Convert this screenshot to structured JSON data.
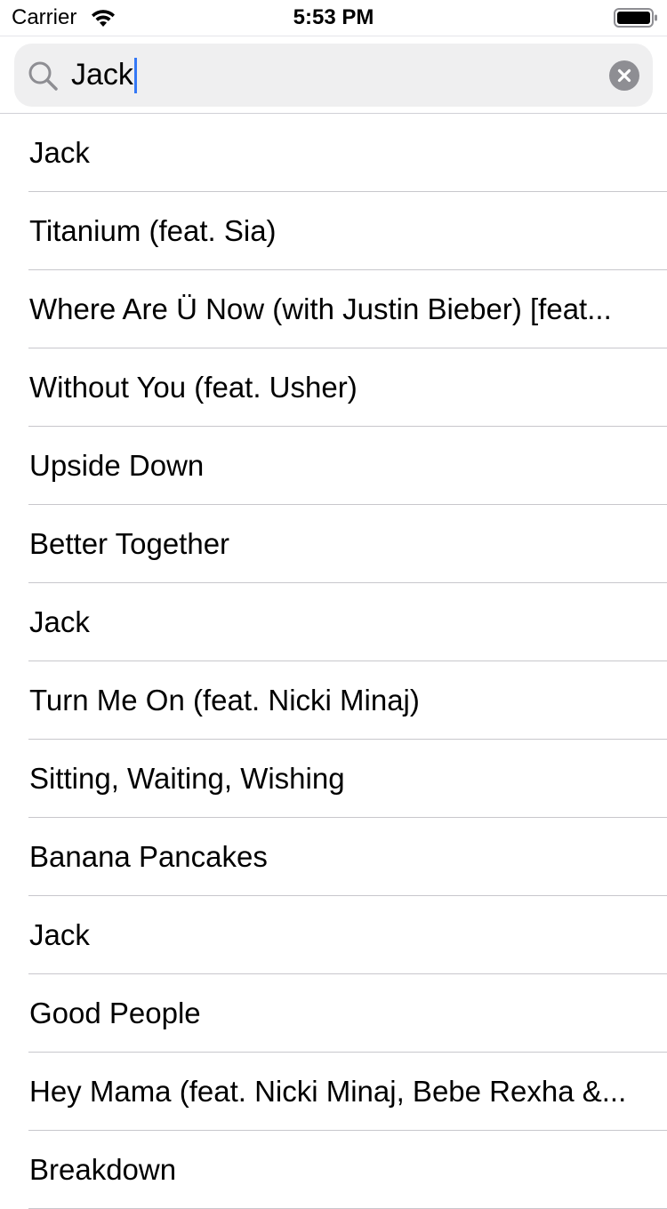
{
  "status_bar": {
    "carrier": "Carrier",
    "time": "5:53 PM"
  },
  "search": {
    "value": "Jack",
    "icon": "search-icon",
    "clear_icon": "clear-icon"
  },
  "results": [
    {
      "label": "Jack"
    },
    {
      "label": "Titanium (feat. Sia)"
    },
    {
      "label": "Where Are Ü Now (with Justin Bieber) [feat..."
    },
    {
      "label": "Without You (feat. Usher)"
    },
    {
      "label": "Upside Down"
    },
    {
      "label": "Better Together"
    },
    {
      "label": "Jack"
    },
    {
      "label": "Turn Me On (feat. Nicki Minaj)"
    },
    {
      "label": "Sitting, Waiting, Wishing"
    },
    {
      "label": "Banana Pancakes"
    },
    {
      "label": "Jack"
    },
    {
      "label": "Good People"
    },
    {
      "label": "Hey Mama (feat. Nicki Minaj, Bebe Rexha &..."
    },
    {
      "label": "Breakdown"
    }
  ],
  "colors": {
    "caret": "#3478f6",
    "search_field_bg": "#efeff0",
    "separator": "#c8c7cc"
  }
}
